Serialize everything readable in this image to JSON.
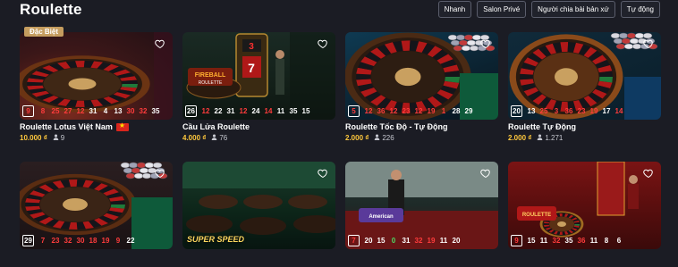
{
  "header": {
    "title": "Roulette",
    "filters": [
      "Nhanh",
      "Salon Privé",
      "Người chia bài bản xứ",
      "Tự động"
    ]
  },
  "games": [
    {
      "badge": "Đặc Biệt",
      "name": "Roulette Lotus Việt Nam",
      "has_flag": true,
      "bet": "10.000 ₫",
      "players": "9",
      "results": [
        "9",
        "8",
        "25",
        "27",
        "12",
        "31",
        "4",
        "13",
        "30",
        "32",
        "35"
      ],
      "colors": [
        "red",
        "red",
        "red",
        "red",
        "red",
        "black",
        "black",
        "black",
        "red",
        "red",
        "black"
      ],
      "theme": "lotus"
    },
    {
      "badge": "",
      "name": "Cầu Lửa Roulette",
      "has_flag": false,
      "bet": "4.000 ₫",
      "players": "76",
      "results": [
        "26",
        "12",
        "22",
        "31",
        "12",
        "24",
        "14",
        "11",
        "35",
        "15"
      ],
      "colors": [
        "black",
        "red",
        "black",
        "black",
        "red",
        "black",
        "red",
        "black",
        "black",
        "black"
      ],
      "theme": "fireball"
    },
    {
      "badge": "",
      "name": "Roulette Tốc Độ - Tự Động",
      "has_flag": false,
      "bet": "2.000 ₫",
      "players": "226",
      "results": [
        "5",
        "12",
        "36",
        "12",
        "23",
        "12",
        "19",
        "1",
        "28",
        "29"
      ],
      "colors": [
        "red",
        "red",
        "red",
        "red",
        "red",
        "red",
        "red",
        "red",
        "black",
        "black"
      ],
      "theme": "speed"
    },
    {
      "badge": "",
      "name": "Roulette Tự Động",
      "has_flag": false,
      "bet": "2.000 ₫",
      "players": "1.271",
      "results": [
        "20",
        "13",
        "25",
        "3",
        "36",
        "23",
        "19",
        "17",
        "14"
      ],
      "colors": [
        "black",
        "black",
        "red",
        "red",
        "red",
        "red",
        "red",
        "black",
        "red"
      ],
      "theme": "auto"
    },
    {
      "badge": "",
      "name": "",
      "has_flag": false,
      "bet": "",
      "players": "",
      "results": [
        "29",
        "7",
        "23",
        "32",
        "30",
        "18",
        "19",
        "9",
        "22"
      ],
      "colors": [
        "black",
        "red",
        "red",
        "red",
        "red",
        "red",
        "red",
        "red",
        "black"
      ],
      "theme": "table5"
    },
    {
      "badge": "",
      "name": "",
      "has_flag": false,
      "bet": "",
      "players": "",
      "brand_text": "SUPER SPEED",
      "results": [],
      "colors": [],
      "theme": "superspeed"
    },
    {
      "badge": "",
      "name": "",
      "has_flag": false,
      "bet": "",
      "players": "",
      "results": [
        "7",
        "20",
        "15",
        "0",
        "31",
        "32",
        "19",
        "11",
        "20"
      ],
      "colors": [
        "red",
        "black",
        "black",
        "green",
        "black",
        "red",
        "red",
        "black",
        "black"
      ],
      "theme": "american"
    },
    {
      "badge": "",
      "name": "",
      "has_flag": false,
      "bet": "",
      "players": "",
      "results": [
        "9",
        "15",
        "11",
        "32",
        "35",
        "36",
        "11",
        "8",
        "6"
      ],
      "colors": [
        "red",
        "black",
        "black",
        "red",
        "black",
        "red",
        "black",
        "black",
        "black"
      ],
      "theme": "reddoor"
    }
  ]
}
